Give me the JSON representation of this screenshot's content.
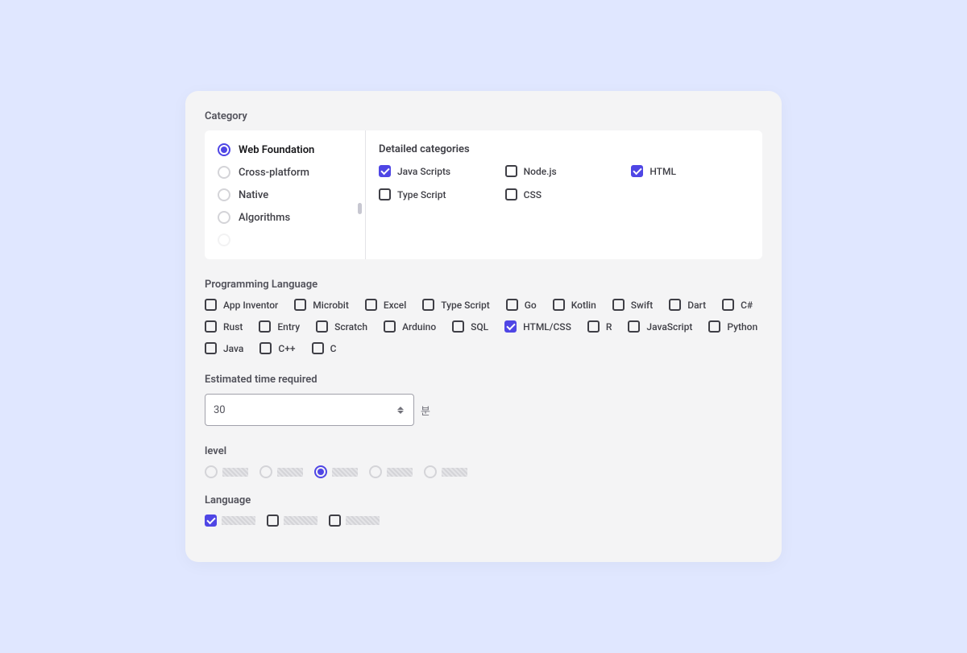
{
  "sections": {
    "category": "Category",
    "programming_language": "Programming Language",
    "estimated_time": "Estimated time required",
    "level": "level",
    "language": "Language"
  },
  "category": {
    "radios": [
      {
        "label": "Web Foundation",
        "selected": true
      },
      {
        "label": "Cross-platform",
        "selected": false
      },
      {
        "label": "Native",
        "selected": false
      },
      {
        "label": "Algorithms",
        "selected": false
      }
    ],
    "detailed_title": "Detailed categories",
    "detailed": [
      {
        "label": "Java Scripts",
        "checked": true
      },
      {
        "label": "Node.js",
        "checked": false
      },
      {
        "label": "HTML",
        "checked": true
      },
      {
        "label": "Type Script",
        "checked": false
      },
      {
        "label": "CSS",
        "checked": false
      }
    ]
  },
  "languages": [
    {
      "label": "App Inventor",
      "checked": false
    },
    {
      "label": "Microbit",
      "checked": false
    },
    {
      "label": "Excel",
      "checked": false
    },
    {
      "label": "Type Script",
      "checked": false
    },
    {
      "label": "Go",
      "checked": false
    },
    {
      "label": "Kotlin",
      "checked": false
    },
    {
      "label": "Swift",
      "checked": false
    },
    {
      "label": "Dart",
      "checked": false
    },
    {
      "label": "C#",
      "checked": false
    },
    {
      "label": "Rust",
      "checked": false
    },
    {
      "label": "Entry",
      "checked": false
    },
    {
      "label": "Scratch",
      "checked": false
    },
    {
      "label": "Arduino",
      "checked": false
    },
    {
      "label": "SQL",
      "checked": false
    },
    {
      "label": "HTML/CSS",
      "checked": true
    },
    {
      "label": "R",
      "checked": false
    },
    {
      "label": "JavaScript",
      "checked": false
    },
    {
      "label": "Python",
      "checked": false
    },
    {
      "label": "Java",
      "checked": false
    },
    {
      "label": "C++",
      "checked": false
    },
    {
      "label": "C",
      "checked": false
    }
  ],
  "time": {
    "value": "30",
    "unit": "분"
  },
  "level": {
    "options": [
      {
        "selected": false
      },
      {
        "selected": false
      },
      {
        "selected": true
      },
      {
        "selected": false
      },
      {
        "selected": false
      }
    ]
  },
  "ui_language": {
    "options": [
      {
        "checked": true
      },
      {
        "checked": false
      },
      {
        "checked": false
      }
    ]
  }
}
